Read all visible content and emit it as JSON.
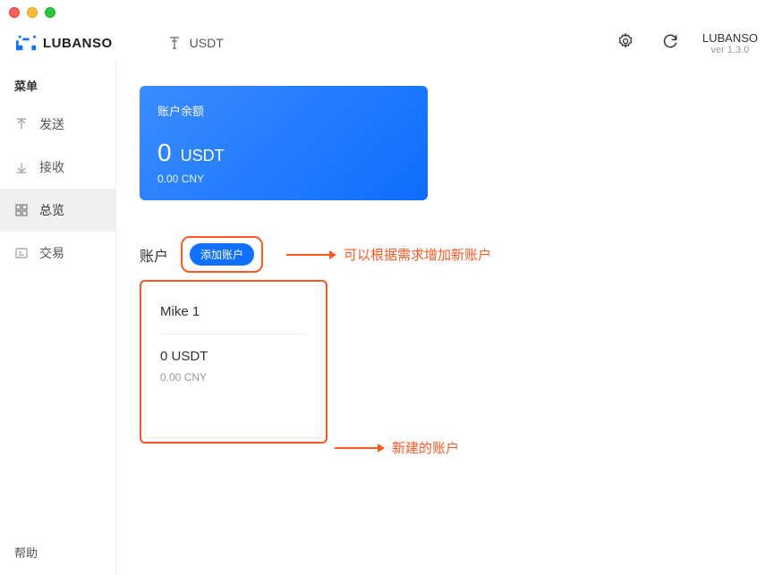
{
  "header": {
    "brand": "LUBANSO",
    "currency": "USDT",
    "brand_right": "LUBANSO",
    "version": "ver 1.3.0"
  },
  "sidebar": {
    "title": "菜单",
    "items": [
      {
        "label": "发送"
      },
      {
        "label": "接收"
      },
      {
        "label": "总览"
      },
      {
        "label": "交易"
      }
    ],
    "help": "帮助"
  },
  "balance": {
    "title": "账户余额",
    "amount": "0",
    "unit": "USDT",
    "sub": "0.00 CNY"
  },
  "accounts": {
    "label": "账户",
    "add_btn": "添加账户"
  },
  "annotations": {
    "add": "可以根据需求增加新账户",
    "new": "新建的账户"
  },
  "account_card": {
    "name": "Mike 1",
    "balance": "0 USDT",
    "sub": "0.00 CNY"
  }
}
